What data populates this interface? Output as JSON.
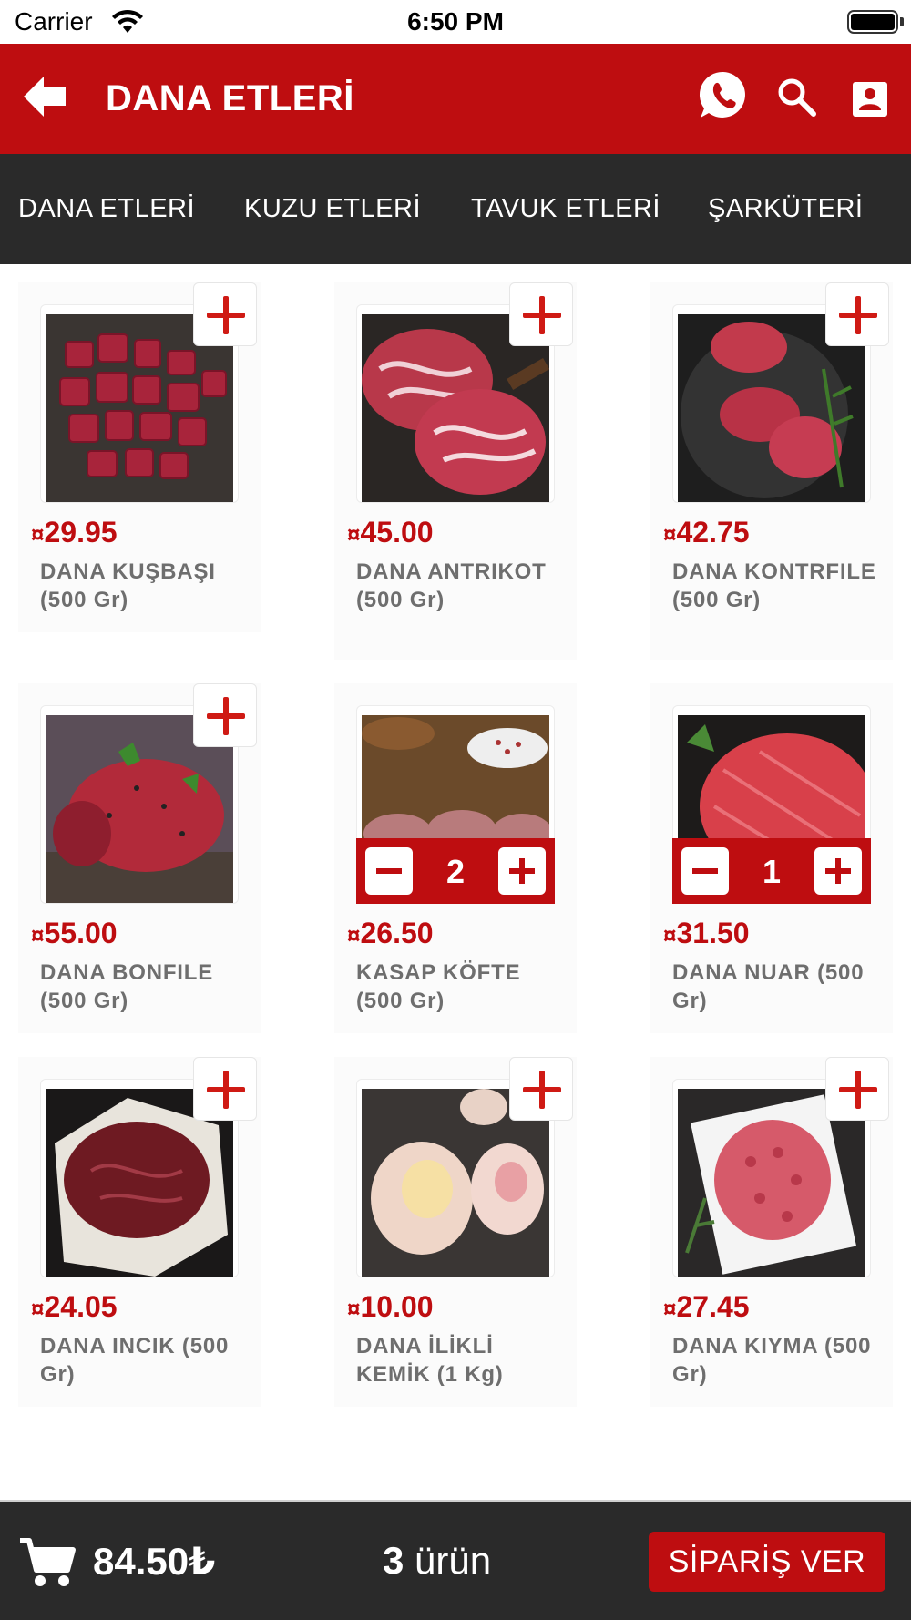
{
  "status_bar": {
    "carrier": "Carrier",
    "time": "6:50 PM"
  },
  "header": {
    "title": "DANA ETLERİ",
    "icons": [
      "back-arrow-icon",
      "whatsapp-icon",
      "search-icon",
      "profile-icon"
    ],
    "accent_color": "#be0d10"
  },
  "categories": [
    {
      "label": "DANA ETLERİ",
      "selected": true
    },
    {
      "label": "KUZU ETLERİ",
      "selected": false
    },
    {
      "label": "TAVUK ETLERİ",
      "selected": false
    },
    {
      "label": "ŞARKÜTERİ",
      "selected": false
    }
  ],
  "products": [
    {
      "currency": "¤",
      "price": "29.95",
      "name": "DANA KUŞBAŞI (500 Gr)",
      "quantity": null,
      "image": "cubed-beef"
    },
    {
      "currency": "¤",
      "price": "45.00",
      "name": "DANA ANTRIKOT (500 Gr)",
      "quantity": null,
      "image": "ribeye-steak"
    },
    {
      "currency": "¤",
      "price": "42.75",
      "name": "DANA KONTRFILE (500 Gr)",
      "quantity": null,
      "image": "sirloin-steaks"
    },
    {
      "currency": "¤",
      "price": "55.00",
      "name": "DANA BONFILE (500 Gr)",
      "quantity": null,
      "image": "tenderloin"
    },
    {
      "currency": "¤",
      "price": "26.50",
      "name": "KASAP KÖFTE (500 Gr)",
      "quantity": "2",
      "image": "meatballs"
    },
    {
      "currency": "¤",
      "price": "31.50",
      "name": "DANA NUAR (500 Gr)",
      "quantity": "1",
      "image": "beef-roast"
    },
    {
      "currency": "¤",
      "price": "24.05",
      "name": "DANA INCIK (500 Gr)",
      "quantity": null,
      "image": "beef-shank"
    },
    {
      "currency": "¤",
      "price": "10.00",
      "name": "DANA İLİKLİ KEMİK (1 Kg)",
      "quantity": null,
      "image": "marrow-bones"
    },
    {
      "currency": "¤",
      "price": "27.45",
      "name": "DANA KIYMA (500 Gr)",
      "quantity": null,
      "image": "ground-beef"
    }
  ],
  "cart": {
    "total": "84.50₺",
    "count": "3",
    "count_unit": "ürün",
    "order_label": "SİPARİŞ VER"
  }
}
